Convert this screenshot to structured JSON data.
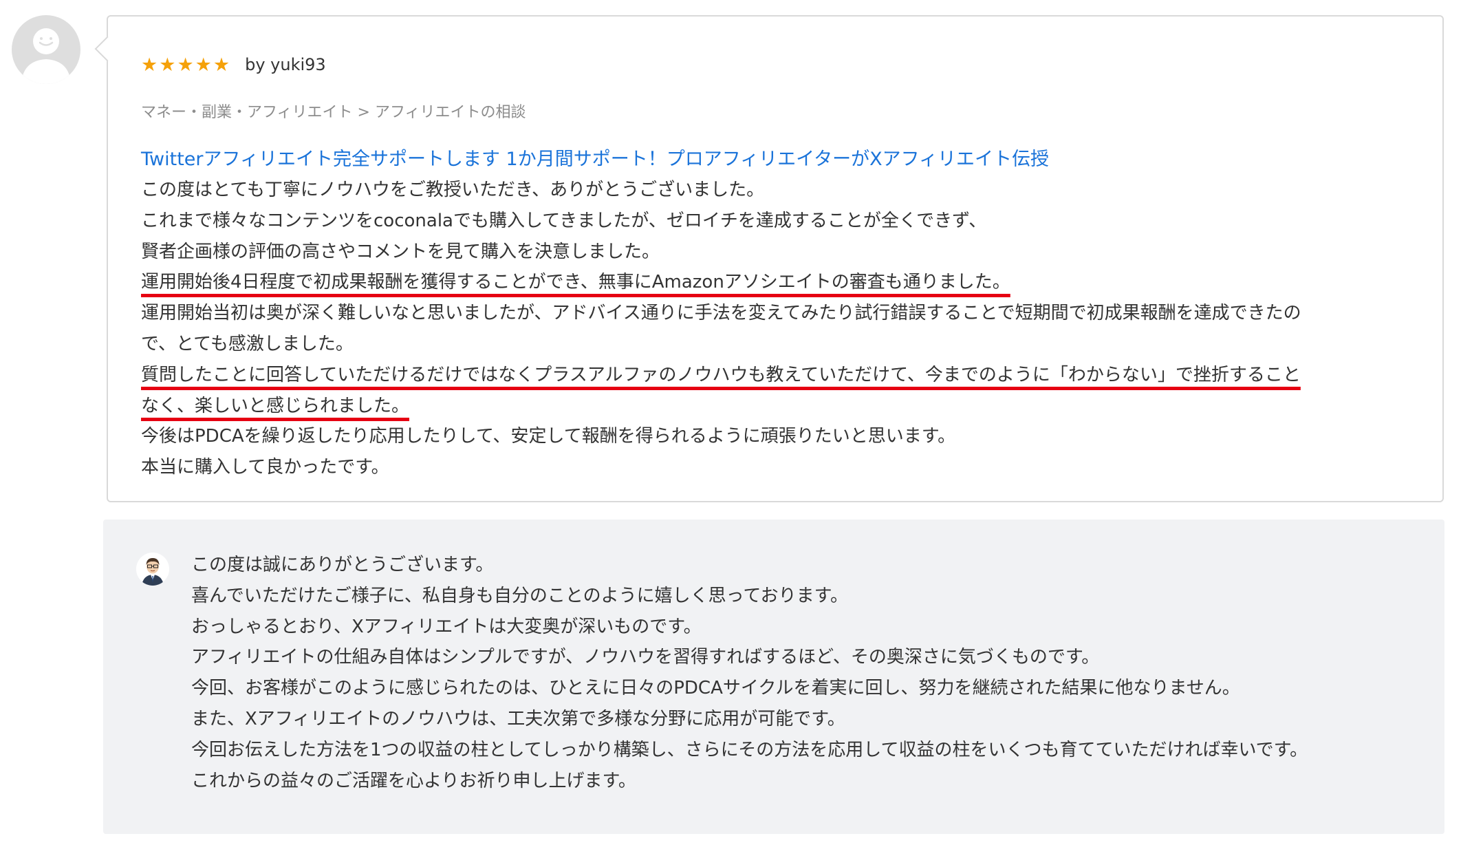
{
  "review": {
    "avatar_icon": "user-silhouette-icon",
    "rating": 5,
    "star_icon": "star-icon",
    "star_color": "#f5a10a",
    "by_user": "by yuki93",
    "breadcrumb": "マネー・副業・アフィリエイト > アフィリエイトの相談",
    "service_title": "Twitterアフィリエイト完全サポートします 1か月間サポート！プロアフィリエイターがXアフィリエイト伝授",
    "link_color": "#1a73d9",
    "underline_color": "#e60012",
    "lines": [
      "この度はとても丁寧にノウハウをご教授いただき、ありがとうございました。",
      "これまで様々なコンテンツをcoconalaでも購入してきましたが、ゼロイチを達成することが全くできず、",
      "賢者企画様の評価の高さやコメントを見て購入を決意しました。",
      "運用開始後4日程度で初成果報酬を獲得することができ、無事にAmazonアソシエイトの審査も通りました。",
      "運用開始当初は奥が深く難しいなと思いましたが、アドバイス通りに手法を変えてみたり試行錯誤することで短期間で初成果報酬を達成できたの",
      "で、とても感激しました。",
      "質問したことに回答していただけるだけではなくプラスアルファのノウハウも教えていただけて、今までのように「わからない」で挫折すること",
      "なく、楽しいと感じられました。",
      "今後はPDCAを繰り返したり応用したりして、安定して報酬を得られるように頑張りたいと思います。",
      "本当に購入して良かったです。"
    ]
  },
  "reply": {
    "seller_avatar_icon": "seller-portrait-icon",
    "background_color": "#f1f2f4",
    "lines": [
      "この度は誠にありがとうございます。",
      "喜んでいただけたご様子に、私自身も自分のことのように嬉しく思っております。",
      "おっしゃるとおり、Xアフィリエイトは大変奥が深いものです。",
      "アフィリエイトの仕組み自体はシンプルですが、ノウハウを習得すればするほど、その奥深さに気づくものです。",
      "今回、お客様がこのように感じられたのは、ひとえに日々のPDCAサイクルを着実に回し、努力を継続された結果に他なりません。",
      "また、Xアフィリエイトのノウハウは、工夫次第で多様な分野に応用が可能です。",
      "今回お伝えした方法を1つの収益の柱としてしっかり構築し、さらにその方法を応用して収益の柱をいくつも育てていただければ幸いです。",
      "これからの益々のご活躍を心よりお祈り申し上げます。"
    ]
  }
}
